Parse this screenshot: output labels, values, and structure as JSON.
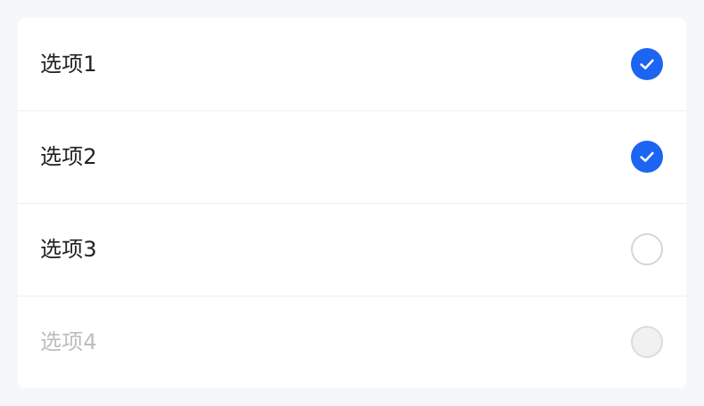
{
  "options": [
    {
      "label": "选项1",
      "checked": true,
      "disabled": false
    },
    {
      "label": "选项2",
      "checked": true,
      "disabled": false
    },
    {
      "label": "选项3",
      "checked": false,
      "disabled": false
    },
    {
      "label": "选项4",
      "checked": false,
      "disabled": true
    }
  ],
  "colors": {
    "accent": "#1c64f2",
    "text": "#222222",
    "disabled_text": "#bdbdbd"
  },
  "icons": {
    "checked": "check-icon"
  }
}
